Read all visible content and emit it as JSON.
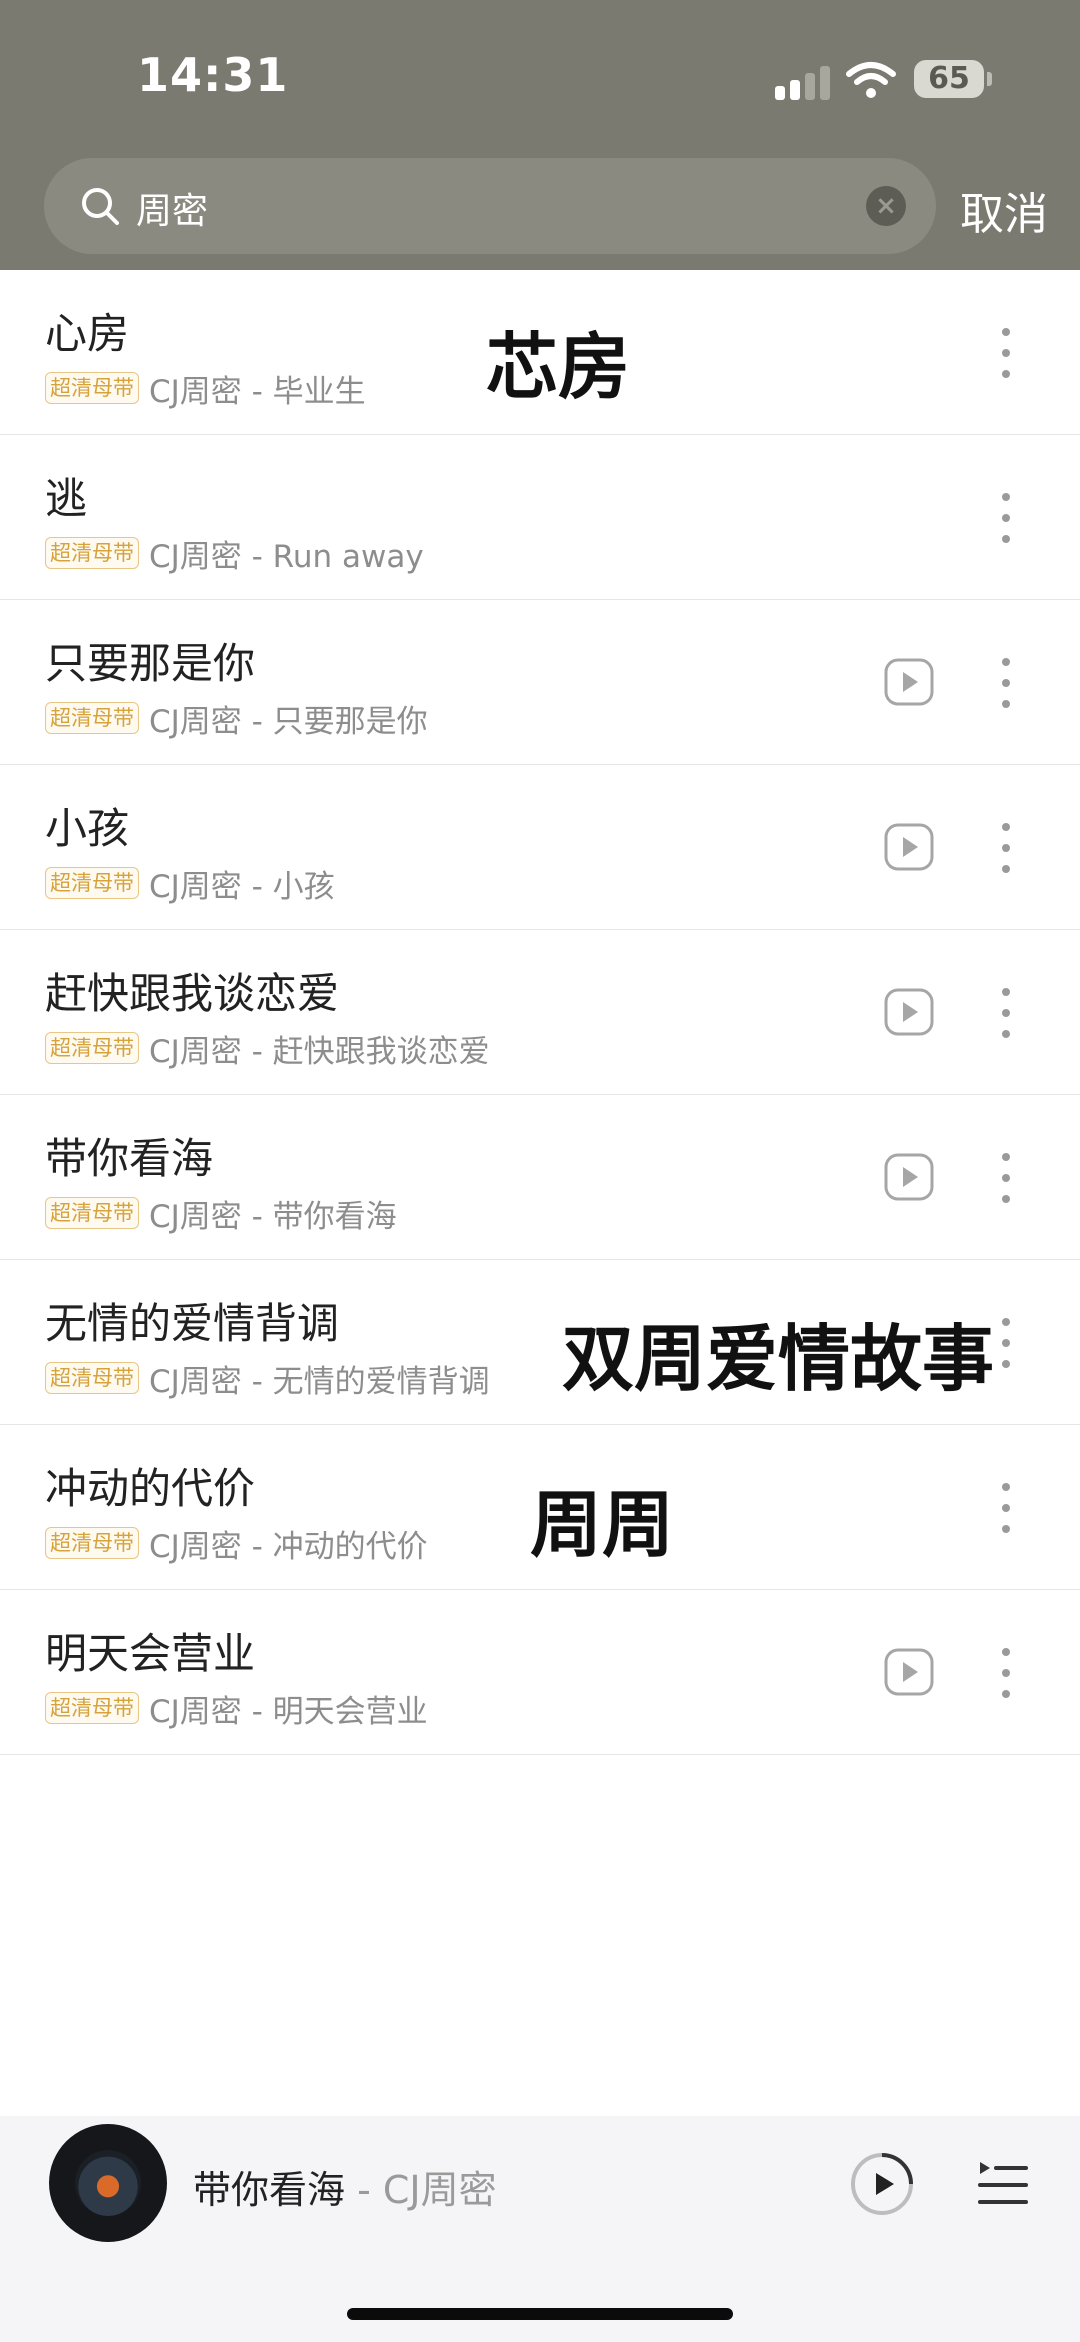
{
  "status_bar": {
    "time": "14:31",
    "battery": "65"
  },
  "search": {
    "query": "周密",
    "cancel_label": "取消"
  },
  "songs": [
    {
      "title": "心房",
      "badge": "超清母带",
      "meta": "CJ周密 - 毕业生",
      "has_video": false
    },
    {
      "title": "逃",
      "badge": "超清母带",
      "meta": "CJ周密 - Run away",
      "has_video": false
    },
    {
      "title": "只要那是你",
      "badge": "超清母带",
      "meta": "CJ周密 - 只要那是你",
      "has_video": true
    },
    {
      "title": "小孩",
      "badge": "超清母带",
      "meta": "CJ周密 - 小孩",
      "has_video": true
    },
    {
      "title": "赶快跟我谈恋爱",
      "badge": "超清母带",
      "meta": "CJ周密 - 赶快跟我谈恋爱",
      "has_video": true
    },
    {
      "title": "带你看海",
      "badge": "超清母带",
      "meta": "CJ周密 - 带你看海",
      "has_video": true
    },
    {
      "title": "无情的爱情背调",
      "badge": "超清母带",
      "meta": "CJ周密 - 无情的爱情背调",
      "has_video": true
    },
    {
      "title": "冲动的代价",
      "badge": "超清母带",
      "meta": "CJ周密 - 冲动的代价",
      "has_video": false
    },
    {
      "title": "明天会营业",
      "badge": "超清母带",
      "meta": "CJ周密 - 明天会营业",
      "has_video": true
    }
  ],
  "overlay_text": {
    "first": "芯房",
    "second": "双周爱情故事",
    "third": "周周"
  },
  "now_playing": {
    "title": "带你看海",
    "separator": " - ",
    "artist": "CJ周密"
  },
  "colors": {
    "badge": "#d6a23b",
    "header": "#7b7a70"
  },
  "icons": {
    "search": "search-icon",
    "clear": "clear-icon",
    "video": "play-video-icon",
    "more": "more-vertical-icon",
    "play": "play-circle-icon",
    "playlist": "playlist-icon"
  }
}
